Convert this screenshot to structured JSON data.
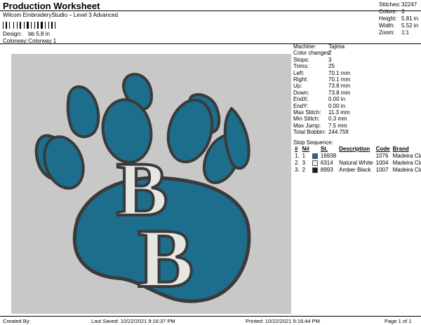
{
  "header": {
    "title": "Production Worksheet",
    "subtitle": "Wilcom EmbroideryStudio – Level 3 Advanced",
    "design_label": "Design:",
    "design_value": "bb 5,8 in",
    "colorway_label": "Colorway:",
    "colorway_value": "Colorway 1"
  },
  "summary": {
    "stitches_label": "Stitches:",
    "stitches_value": "32247",
    "colors_label": "Colors:",
    "colors_value": "3",
    "height_label": "Height:",
    "height_value": "5.81 in",
    "width_label": "Width:",
    "width_value": "5.52 in",
    "zoom_label": "Zoom:",
    "zoom_value": "1:1"
  },
  "design": {
    "letters": "BB",
    "colors": {
      "background": "#c8c8c8",
      "blue": "#1d6d8c",
      "outline": "#3a3a3a",
      "white": "#e6e6e2"
    }
  },
  "info": [
    {
      "label": "Machine:",
      "value": "Tajima"
    },
    {
      "label": "Color changes:",
      "value": "2"
    },
    {
      "label": "Stops:",
      "value": "3"
    },
    {
      "label": "Trims:",
      "value": "25"
    },
    {
      "label": "Left:",
      "value": "70.1 mm"
    },
    {
      "label": "Right:",
      "value": "70.1 mm"
    },
    {
      "label": "Up:",
      "value": "73.8 mm"
    },
    {
      "label": "Down:",
      "value": "73.8 mm"
    },
    {
      "label": "EndX:",
      "value": "0.00 in"
    },
    {
      "label": "EndY:",
      "value": "0.00 in"
    },
    {
      "label": "Max Stitch:",
      "value": "11.3 mm"
    },
    {
      "label": "Min Stitch:",
      "value": "0.3 mm"
    },
    {
      "label": "Max Jump:",
      "value": "7.5 mm"
    },
    {
      "label": "Total Bobbin:",
      "value": "244.75ft"
    }
  ],
  "stop_sequence": {
    "title": "Stop Sequence:",
    "headers": [
      "#",
      "N#",
      "St.",
      "Description",
      "Code",
      "Brand"
    ],
    "rows": [
      {
        "num": "1.",
        "n": "1",
        "color": "#1d6d8c",
        "st": "16938",
        "desc": "",
        "code": "1076",
        "brand": "Madeira Classic 40"
      },
      {
        "num": "2.",
        "n": "3",
        "color": "#f2f2ee",
        "st": "6314",
        "desc": "Natural White",
        "code": "1004",
        "brand": "Madeira Classic 40"
      },
      {
        "num": "3.",
        "n": "2",
        "color": "#1a1a1a",
        "st": "8993",
        "desc": "Amber Black",
        "code": "1007",
        "brand": "Madeira Classic 40"
      }
    ]
  },
  "footer": {
    "created_by": "Created By:",
    "last_saved": "Last Saved: 10/22/2021 9:16:37 PM",
    "printed": "Printed: 10/22/2021 9:16:44 PM",
    "page": "Page 1 of 1"
  }
}
